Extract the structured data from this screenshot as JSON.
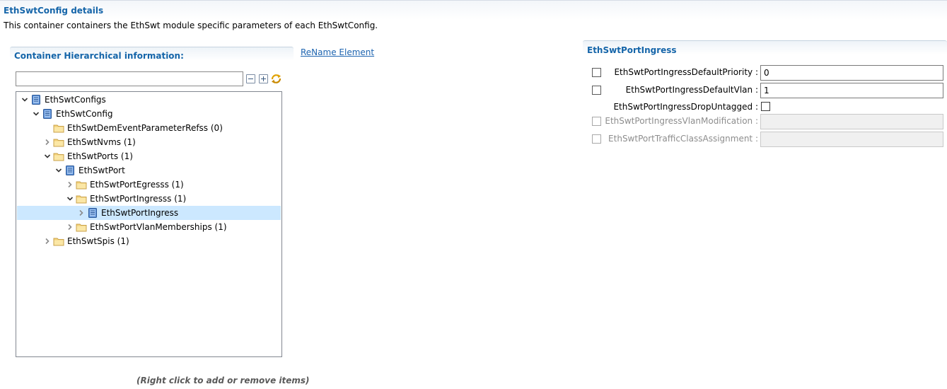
{
  "header": {
    "title": "EthSwtConfig details",
    "description": "This container containers the EthSwt module specific parameters of each EthSwtConfig."
  },
  "hierarchy": {
    "title": "Container Hierarchical information:",
    "filter_value": "",
    "rename_label": "ReName Element",
    "footer_hint": "(Right click to add or remove items)",
    "tree": [
      {
        "label": "EthSwtConfigs",
        "type": "container",
        "level": 0,
        "expander": "expanded",
        "selected": false
      },
      {
        "label": "EthSwtConfig",
        "type": "container",
        "level": 1,
        "expander": "expanded",
        "selected": false
      },
      {
        "label": "EthSwtDemEventParameterRefss (0)",
        "type": "folder",
        "level": 2,
        "expander": "none",
        "selected": false
      },
      {
        "label": "EthSwtNvms (1)",
        "type": "folder",
        "level": 2,
        "expander": "collapsed",
        "selected": false
      },
      {
        "label": "EthSwtPorts (1)",
        "type": "folder",
        "level": 2,
        "expander": "expanded",
        "selected": false
      },
      {
        "label": "EthSwtPort",
        "type": "container",
        "level": 3,
        "expander": "expanded",
        "selected": false
      },
      {
        "label": "EthSwtPortEgresss (1)",
        "type": "folder",
        "level": 4,
        "expander": "collapsed",
        "selected": false
      },
      {
        "label": "EthSwtPortIngresss (1)",
        "type": "folder",
        "level": 4,
        "expander": "expanded",
        "selected": false
      },
      {
        "label": "EthSwtPortIngress",
        "type": "container",
        "level": 5,
        "expander": "collapsed",
        "selected": true
      },
      {
        "label": "EthSwtPortVlanMemberships (1)",
        "type": "folder",
        "level": 4,
        "expander": "collapsed",
        "selected": false
      },
      {
        "label": "EthSwtSpis (1)",
        "type": "folder",
        "level": 2,
        "expander": "collapsed",
        "selected": false
      }
    ]
  },
  "params": {
    "title": "EthSwtPortIngress",
    "rows": [
      {
        "label": "EthSwtPortIngressDefaultPriority :",
        "value": "0",
        "kind": "text",
        "enabled": true
      },
      {
        "label": "EthSwtPortIngressDefaultVlan :",
        "value": "1",
        "kind": "text",
        "enabled": true
      },
      {
        "label": "EthSwtPortIngressDropUntagged :",
        "value": "",
        "kind": "checkbox",
        "enabled": true
      },
      {
        "label": "EthSwtPortIngressVlanModification :",
        "value": "",
        "kind": "text",
        "enabled": false
      },
      {
        "label": "EthSwtPortTrafficClassAssignment :",
        "value": "",
        "kind": "text",
        "enabled": false
      }
    ]
  },
  "icons": {
    "collapse_all": "collapse-all-icon",
    "expand_all": "expand-all-icon",
    "sync": "sync-icon",
    "container": "container-icon",
    "folder": "folder-icon"
  },
  "colors": {
    "accent": "#1565a9",
    "link": "#1d64b0",
    "selection": "#cce8ff"
  }
}
